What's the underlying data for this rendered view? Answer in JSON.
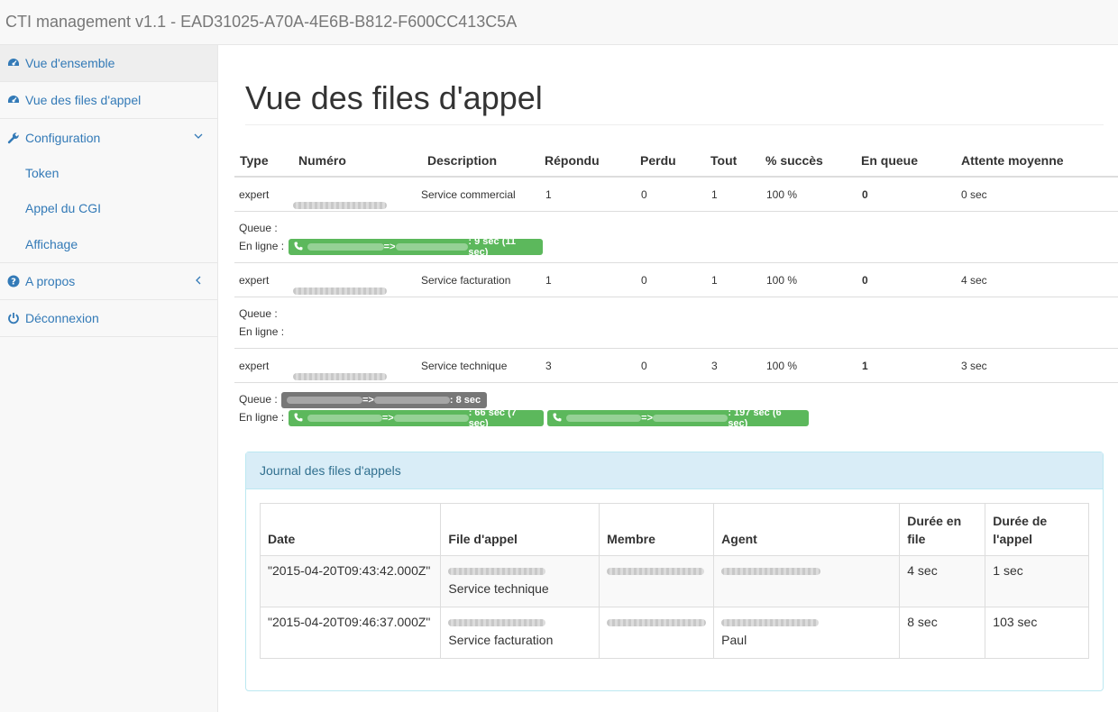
{
  "app": {
    "title": "CTI management v1.1 - EAD31025-A70A-4E6B-B812-F600CC413C5A"
  },
  "sidebar": {
    "items": [
      {
        "label": "Vue d'ensemble",
        "icon": "dashboard-icon"
      },
      {
        "label": "Vue des files d'appel",
        "icon": "dashboard-icon"
      },
      {
        "label": "Configuration",
        "icon": "wrench-icon"
      },
      {
        "label": "A propos",
        "icon": "question-circle-icon"
      },
      {
        "label": "Déconnexion",
        "icon": "power-icon"
      }
    ],
    "config_subitems": [
      "Token",
      "Appel du CGI",
      "Affichage"
    ]
  },
  "main": {
    "title": "Vue des files d'appel",
    "queue_table": {
      "headers": [
        "Type",
        "Numéro",
        "Description",
        "Répondu",
        "Perdu",
        "Tout",
        "% succès",
        "En queue",
        "Attente moyenne"
      ],
      "queue_label": "Queue :",
      "online_label": "En ligne :",
      "arrow": "=>",
      "rows": [
        {
          "type": "expert",
          "description": "Service commercial",
          "repondu": "1",
          "perdu": "0",
          "tout": "1",
          "succes": "100 %",
          "en_queue": "0",
          "attente": "0 sec",
          "queue_calls": [],
          "online_calls": [
            ": 9 sec (11 sec)"
          ]
        },
        {
          "type": "expert",
          "description": "Service facturation",
          "repondu": "1",
          "perdu": "0",
          "tout": "1",
          "succes": "100 %",
          "en_queue": "0",
          "attente": "4 sec",
          "queue_calls": [],
          "online_calls": []
        },
        {
          "type": "expert",
          "description": "Service technique",
          "repondu": "3",
          "perdu": "0",
          "tout": "3",
          "succes": "100 %",
          "en_queue": "1",
          "attente": "3 sec",
          "queue_calls": [
            ": 8 sec"
          ],
          "online_calls": [
            ": 66 sec (7 sec)",
            ": 197 sec (6 sec)"
          ]
        }
      ]
    },
    "journal": {
      "heading": "Journal des files d'appels",
      "headers": [
        "Date",
        "File d'appel",
        "Membre",
        "Agent",
        "Durée en file",
        "Durée de l'appel"
      ],
      "rows": [
        {
          "date": "\"2015-04-20T09:43:42.000Z\"",
          "file": "Service technique",
          "agent": "",
          "duree_file": "4 sec",
          "duree_appel": "1 sec"
        },
        {
          "date": "\"2015-04-20T09:46:37.000Z\"",
          "file": "Service facturation",
          "agent": "Paul",
          "duree_file": "8 sec",
          "duree_appel": "103 sec"
        }
      ]
    }
  }
}
